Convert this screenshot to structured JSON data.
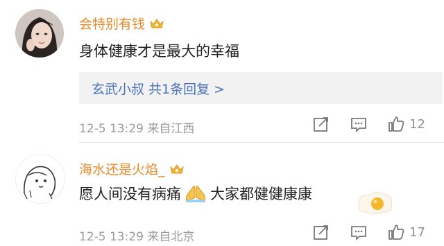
{
  "comments": [
    {
      "username": "会特别有钱",
      "text": "身体健康才是最大的幸福",
      "reply_link": "玄武小叔  共1条回复 >",
      "meta": "12-5 13:29  来自江西",
      "like_count": "12"
    },
    {
      "username": "海水还是火焰_",
      "text_before": "愿人间没有病痛",
      "text_after": "大家都健健康康",
      "meta": "12-5 13:29  来自北京",
      "like_count": "17"
    }
  ],
  "colors": {
    "username": "#ea8a2a",
    "link": "#4a73b8",
    "meta": "#9b9b9b"
  },
  "icons": [
    "crown-icon",
    "share-icon",
    "comment-icon",
    "like-icon",
    "pray-emoji-icon"
  ]
}
